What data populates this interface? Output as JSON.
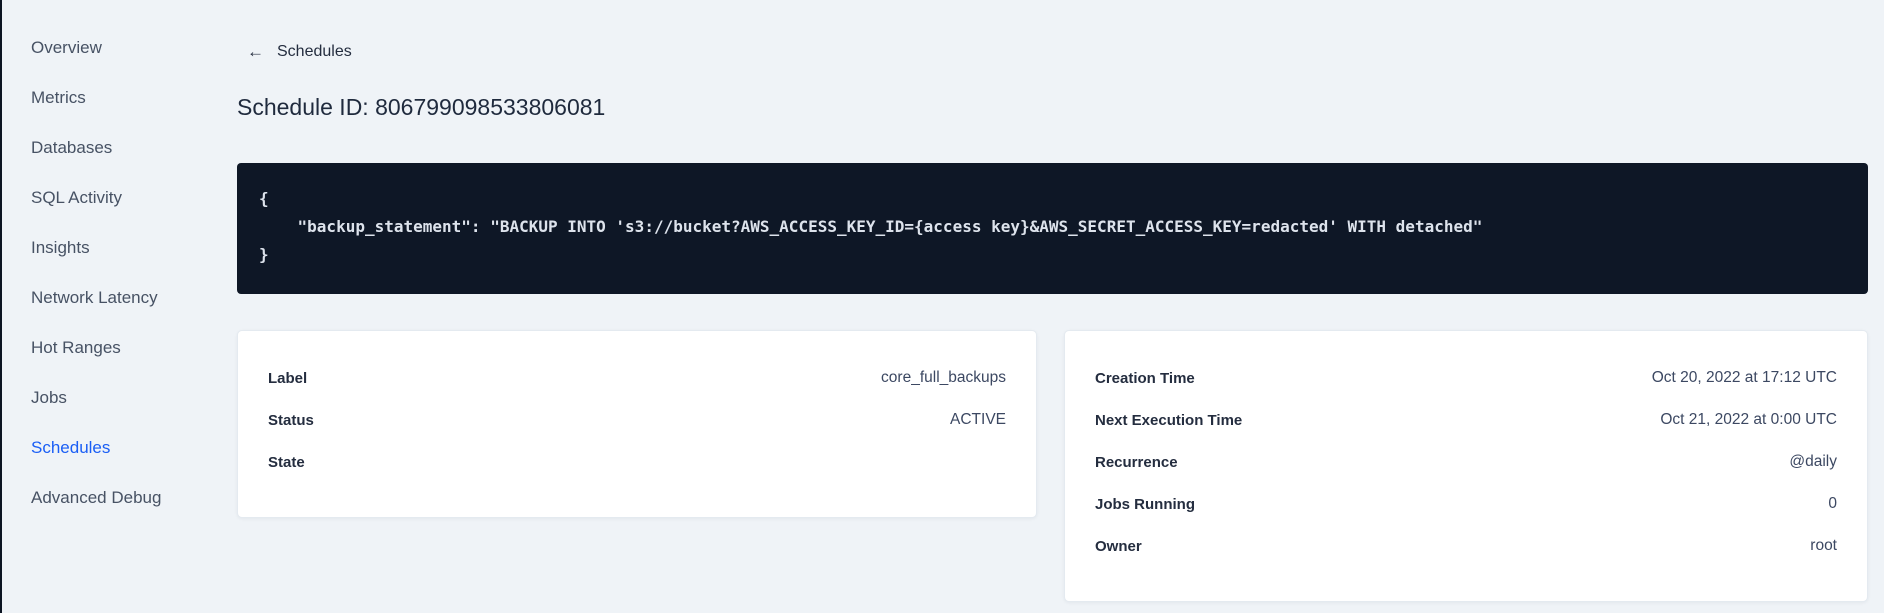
{
  "sidebar": {
    "items": [
      {
        "label": "Overview",
        "active": false
      },
      {
        "label": "Metrics",
        "active": false
      },
      {
        "label": "Databases",
        "active": false
      },
      {
        "label": "SQL Activity",
        "active": false
      },
      {
        "label": "Insights",
        "active": false
      },
      {
        "label": "Network Latency",
        "active": false
      },
      {
        "label": "Hot Ranges",
        "active": false
      },
      {
        "label": "Jobs",
        "active": false
      },
      {
        "label": "Schedules",
        "active": true
      },
      {
        "label": "Advanced Debug",
        "active": false
      }
    ]
  },
  "header": {
    "back_arrow": "←",
    "back_label": "Schedules",
    "title": "Schedule ID: 806799098533806081"
  },
  "code_block": {
    "lines": [
      "{",
      "    \"backup_statement\": \"BACKUP INTO 's3://bucket?AWS_ACCESS_KEY_ID={access key}&AWS_SECRET_ACCESS_KEY=redacted' WITH detached\"",
      "}"
    ]
  },
  "details_card": {
    "rows": [
      {
        "label": "Label",
        "value": "core_full_backups"
      },
      {
        "label": "Status",
        "value": "ACTIVE"
      },
      {
        "label": "State",
        "value": ""
      }
    ]
  },
  "schedule_card": {
    "rows": [
      {
        "label": "Creation Time",
        "value": "Oct 20, 2022 at 17:12 UTC"
      },
      {
        "label": "Next Execution Time",
        "value": "Oct 21, 2022 at 0:00 UTC"
      },
      {
        "label": "Recurrence",
        "value": "@daily"
      },
      {
        "label": "Jobs Running",
        "value": "0"
      },
      {
        "label": "Owner",
        "value": "root"
      }
    ]
  },
  "colors": {
    "accent_blue": "#1a5ef5",
    "code_bg": "#0e1726",
    "page_bg": "#eff3f7",
    "left_strip": "#0c1422"
  }
}
